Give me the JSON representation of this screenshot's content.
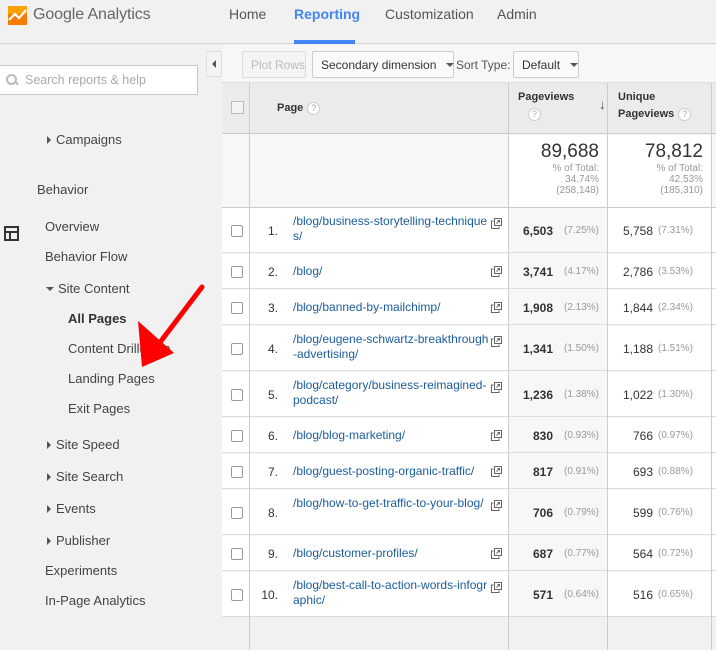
{
  "app": {
    "logo_text": "Google Analytics",
    "accent_color": "#4285f4",
    "logo_colors": [
      "#f57c00",
      "#ffa000"
    ]
  },
  "nav": {
    "items": [
      {
        "label": "Home",
        "active": false
      },
      {
        "label": "Reporting",
        "active": true
      },
      {
        "label": "Customization",
        "active": false
      },
      {
        "label": "Admin",
        "active": false
      }
    ]
  },
  "sidebar": {
    "search_placeholder": "Search reports & help",
    "items": [
      {
        "label": "Campaigns",
        "type": "collapsed"
      },
      {
        "label": "Behavior",
        "type": "section"
      },
      {
        "label": "Overview",
        "type": "link"
      },
      {
        "label": "Behavior Flow",
        "type": "link"
      },
      {
        "label": "Site Content",
        "type": "expanded"
      },
      {
        "label": "All Pages",
        "type": "selected"
      },
      {
        "label": "Content Drilldown",
        "type": "link"
      },
      {
        "label": "Landing Pages",
        "type": "link"
      },
      {
        "label": "Exit Pages",
        "type": "link"
      },
      {
        "label": "Site Speed",
        "type": "collapsed"
      },
      {
        "label": "Site Search",
        "type": "collapsed"
      },
      {
        "label": "Events",
        "type": "collapsed"
      },
      {
        "label": "Publisher",
        "type": "collapsed"
      },
      {
        "label": "Experiments",
        "type": "link"
      },
      {
        "label": "In-Page Analytics",
        "type": "link"
      }
    ],
    "annotation_color": "#ff0000"
  },
  "toolbar": {
    "plot_rows": "Plot Rows",
    "secondary_dimension": "Secondary dimension",
    "sort_type_label": "Sort Type:",
    "sort_type_value": "Default"
  },
  "table": {
    "headers": {
      "page": "Page",
      "pageviews": "Pageviews",
      "unique_line1": "Unique",
      "unique_line2": "Pageviews",
      "help": "?"
    },
    "sort_arrow": "↓",
    "totals": {
      "pageviews": {
        "value": "89,688",
        "pct_label": "% of Total:",
        "pct": "34.74%",
        "total": "(258,148)"
      },
      "unique": {
        "value": "78,812",
        "pct_label": "% of Total:",
        "pct": "42.53%",
        "total": "(185,310)"
      }
    },
    "rows": [
      {
        "idx": "1.",
        "page": "/blog/business-storytelling-techniques/",
        "pv": "6,503",
        "pvp": "(7.25%)",
        "upv": "5,758",
        "upvp": "(7.31%)"
      },
      {
        "idx": "2.",
        "page": "/blog/",
        "pv": "3,741",
        "pvp": "(4.17%)",
        "upv": "2,786",
        "upvp": "(3.53%)"
      },
      {
        "idx": "3.",
        "page": "/blog/banned-by-mailchimp/",
        "pv": "1,908",
        "pvp": "(2.13%)",
        "upv": "1,844",
        "upvp": "(2.34%)"
      },
      {
        "idx": "4.",
        "page": "/blog/eugene-schwartz-breakthrough-advertising/",
        "pv": "1,341",
        "pvp": "(1.50%)",
        "upv": "1,188",
        "upvp": "(1.51%)"
      },
      {
        "idx": "5.",
        "page": "/blog/category/business-reimagined-podcast/",
        "pv": "1,236",
        "pvp": "(1.38%)",
        "upv": "1,022",
        "upvp": "(1.30%)"
      },
      {
        "idx": "6.",
        "page": "/blog/blog-marketing/",
        "pv": "830",
        "pvp": "(0.93%)",
        "upv": "766",
        "upvp": "(0.97%)"
      },
      {
        "idx": "7.",
        "page": "/blog/guest-posting-organic-traffic/",
        "pv": "817",
        "pvp": "(0.91%)",
        "upv": "693",
        "upvp": "(0.88%)"
      },
      {
        "idx": "8.",
        "page": "/blog/how-to-get-traffic-to-your-blog/",
        "pv": "706",
        "pvp": "(0.79%)",
        "upv": "599",
        "upvp": "(0.76%)"
      },
      {
        "idx": "9.",
        "page": "/blog/customer-profiles/",
        "pv": "687",
        "pvp": "(0.77%)",
        "upv": "564",
        "upvp": "(0.72%)"
      },
      {
        "idx": "10.",
        "page": "/blog/best-call-to-action-words-infographic/",
        "pv": "571",
        "pvp": "(0.64%)",
        "upv": "516",
        "upvp": "(0.65%)"
      }
    ]
  }
}
